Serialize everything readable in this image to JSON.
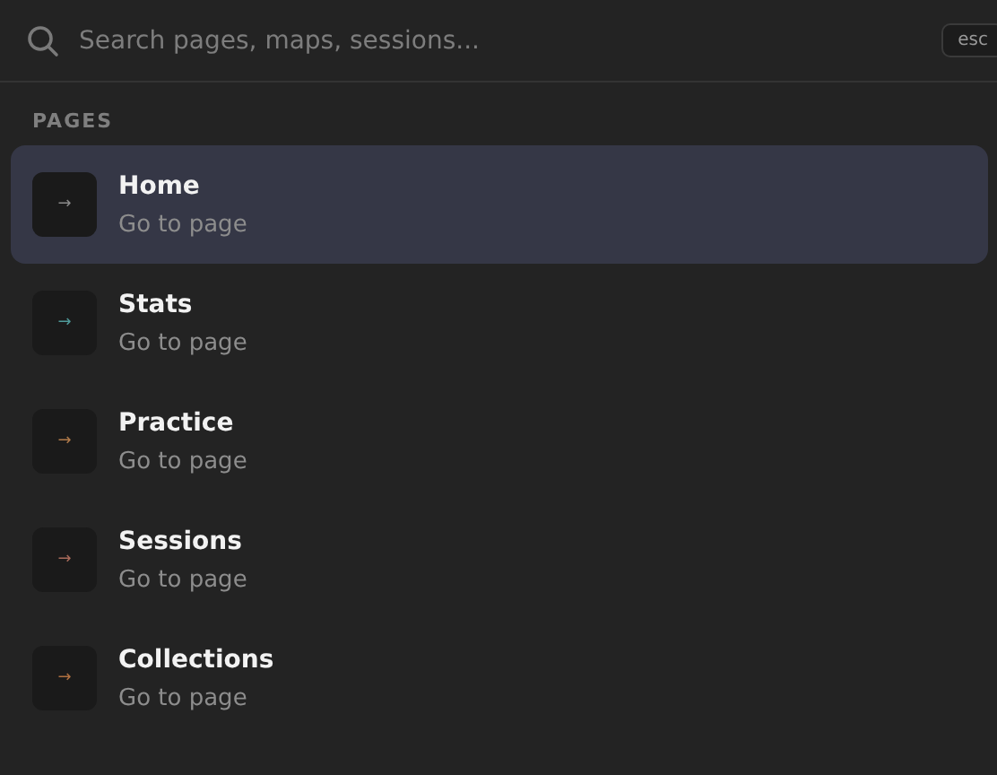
{
  "search": {
    "placeholder": "Search pages, maps, sessions...",
    "shortcut": "esc"
  },
  "section": {
    "label": "PAGES"
  },
  "items": [
    {
      "title": "Home",
      "subtitle": "Go to page",
      "icon": "→",
      "color": "#8a8a8a",
      "selected": true
    },
    {
      "title": "Stats",
      "subtitle": "Go to page",
      "icon": "→",
      "color": "#4f9a9a",
      "selected": false
    },
    {
      "title": "Practice",
      "subtitle": "Go to page",
      "icon": "→",
      "color": "#b07a4a",
      "selected": false
    },
    {
      "title": "Sessions",
      "subtitle": "Go to page",
      "icon": "→",
      "color": "#a86a5a",
      "selected": false
    },
    {
      "title": "Collections",
      "subtitle": "Go to page",
      "icon": "→",
      "color": "#b07040",
      "selected": false
    }
  ]
}
